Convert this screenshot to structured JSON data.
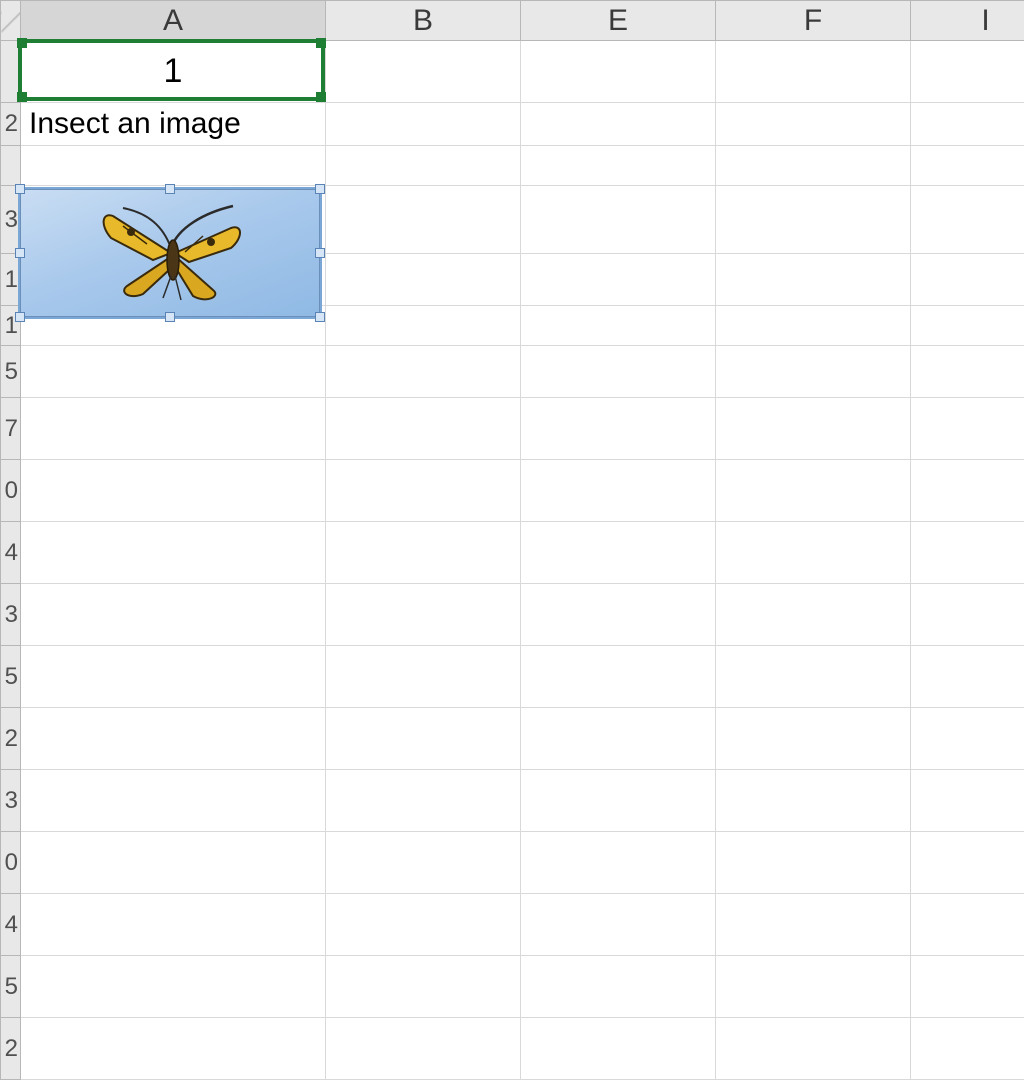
{
  "columns": [
    "A",
    "B",
    "E",
    "F",
    "I"
  ],
  "selected_cell": "A1",
  "selection_color": "#1e7e34",
  "image_selection_color": "#7aa7d6",
  "cells": {
    "A1": "1",
    "A2": "Insect an image"
  },
  "row_headers": [
    "",
    "2",
    "",
    "3",
    "1",
    "1",
    "5",
    "7",
    "0",
    "4",
    "3",
    "5",
    "2",
    "3",
    "0",
    "4",
    "5",
    "2"
  ],
  "inserted_image": {
    "name": "butterfly-image",
    "selected": true
  }
}
